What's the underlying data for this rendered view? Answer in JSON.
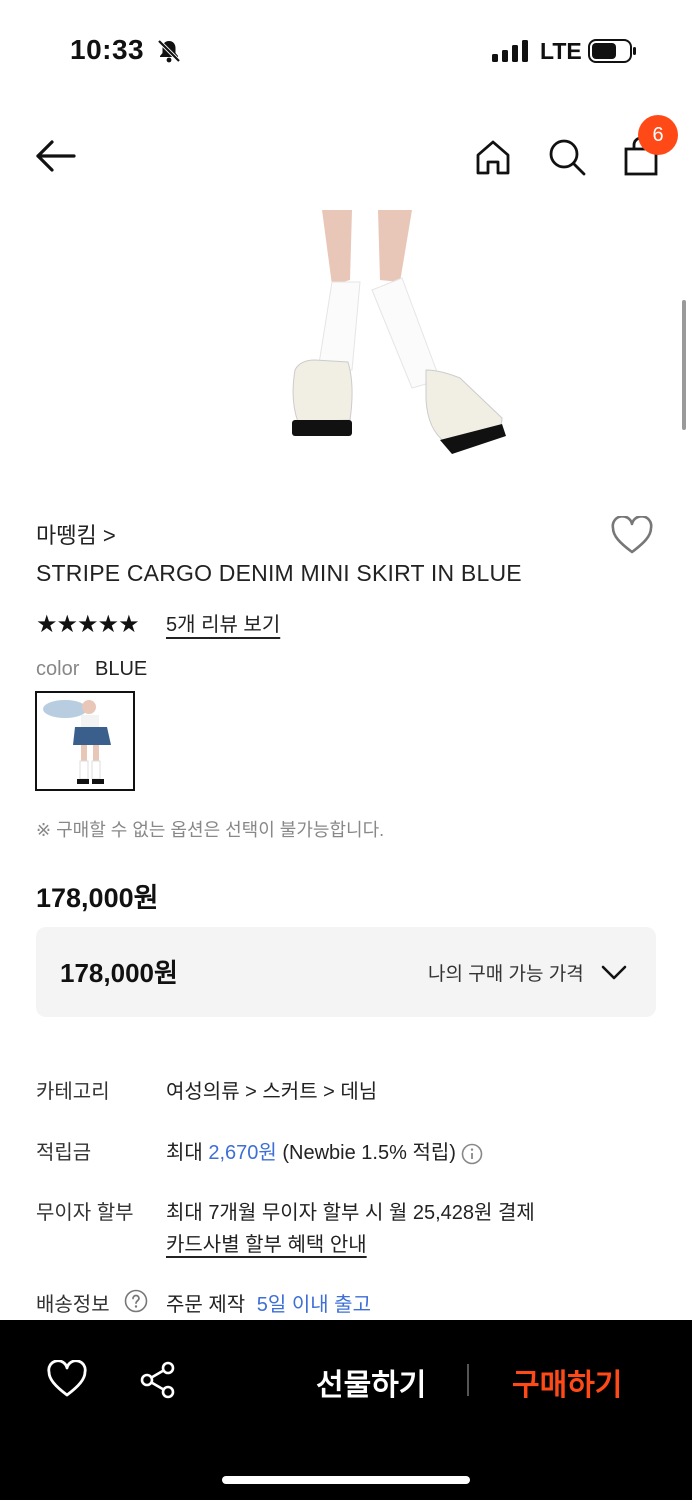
{
  "status_bar": {
    "time": "10:33",
    "network": "LTE"
  },
  "header": {
    "cart_count": "6"
  },
  "product": {
    "brand": "마뗑킴 >",
    "title": "STRIPE CARGO DENIM MINI SKIRT IN BLUE",
    "rating_stars": "★★★★★",
    "review_link": "5개 리뷰 보기",
    "color_label": "color",
    "color_value": "BLUE",
    "option_notice": "※ 구매할 수 없는 옵션은 선택이 불가능합니다.",
    "price": "178,000원"
  },
  "price_box": {
    "price": "178,000원",
    "label": "나의 구매 가능 가격"
  },
  "details": {
    "category": {
      "label": "카테고리",
      "path": "여성의류 > 스커트 > 데님"
    },
    "points": {
      "label": "적립금",
      "prefix": "최대",
      "amount": "2,670원",
      "suffix": "(Newbie 1.5% 적립)"
    },
    "installment": {
      "label": "무이자 할부",
      "text": "최대 7개월 무이자 할부 시 월 25,428원 결제",
      "link": "카드사별 할부 혜택 안내"
    },
    "shipping": {
      "label": "배송정보",
      "prefix": "주문 제작",
      "eta": "5일 이내 출고"
    }
  },
  "bottom_bar": {
    "gift": "선물하기",
    "buy": "구매하기"
  },
  "colors": {
    "accent": "#ff4a17",
    "link_blue": "#3e6fd6"
  }
}
